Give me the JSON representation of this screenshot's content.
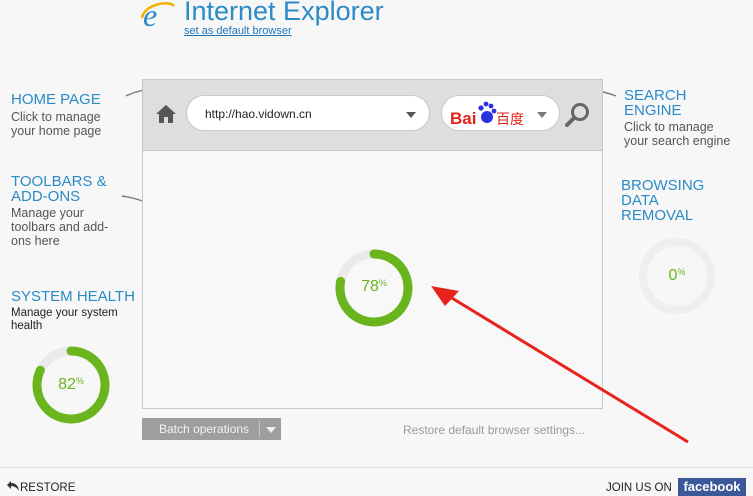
{
  "header": {
    "title": "Internet Explorer",
    "default_link": "set as default browser"
  },
  "left": {
    "home_page": {
      "title": "HOME PAGE",
      "desc": [
        "Click to manage",
        "your home page"
      ]
    },
    "toolbars": {
      "title": [
        "TOOLBARS &",
        "ADD-ONS"
      ],
      "desc": [
        "Manage your",
        "toolbars and add-",
        "ons here"
      ]
    },
    "health": {
      "title": "SYSTEM HEALTH",
      "desc": [
        "Manage your system",
        "health"
      ],
      "value": 82,
      "label": "82"
    }
  },
  "right": {
    "search": {
      "title": [
        "SEARCH",
        "ENGINE"
      ],
      "desc": [
        "Click to manage",
        "your search engine"
      ]
    },
    "browsing": {
      "title": [
        "BROWSING",
        "DATA",
        "REMOVAL"
      ],
      "value": 0,
      "label": "0"
    }
  },
  "browser": {
    "url": "http://hao.vidown.cn",
    "search_engine": {
      "name_latin": "Bai",
      "name_cn": "百度",
      "icon": "paw-icon"
    },
    "gauge": {
      "value": 78,
      "label": "78"
    }
  },
  "footer": {
    "batch": "Batch operations",
    "restore_defaults": "Restore default browser settings...",
    "restore": "RESTORE",
    "join": "JOIN US ON",
    "facebook": "facebook"
  },
  "colors": {
    "accent": "#2a8bc6",
    "gauge_green": "#6ab51e",
    "arrow_red": "#e8231d"
  }
}
